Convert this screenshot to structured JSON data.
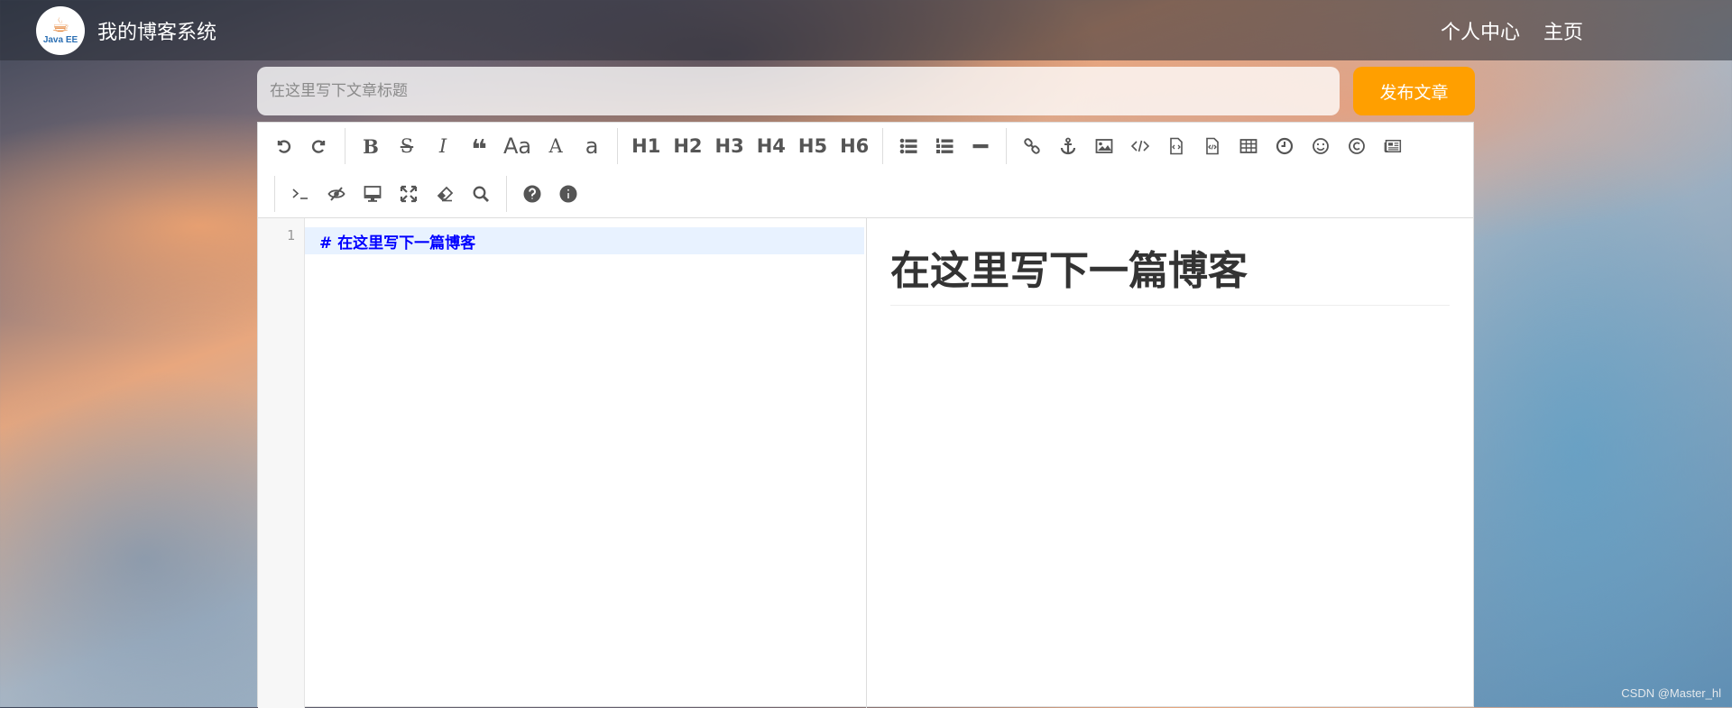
{
  "header": {
    "logo_text": "Java EE",
    "site_title": "我的博客系统",
    "nav": [
      "个人中心",
      "主页"
    ]
  },
  "title_row": {
    "placeholder": "在这里写下文章标题",
    "publish_label": "发布文章"
  },
  "toolbar": {
    "headings": [
      "H1",
      "H2",
      "H3",
      "H4",
      "H5",
      "H6"
    ],
    "bold": "B",
    "strike": "S",
    "italic": "I",
    "case_upper": "Aa",
    "case_A": "A",
    "case_a": "a"
  },
  "editor": {
    "line_number": "1",
    "code": "#  在这里写下一篇博客",
    "preview_heading": "在这里写下一篇博客"
  },
  "watermark": "CSDN @Master_hl",
  "colors": {
    "accent": "#ff9f00",
    "code_text": "#0000ff"
  }
}
